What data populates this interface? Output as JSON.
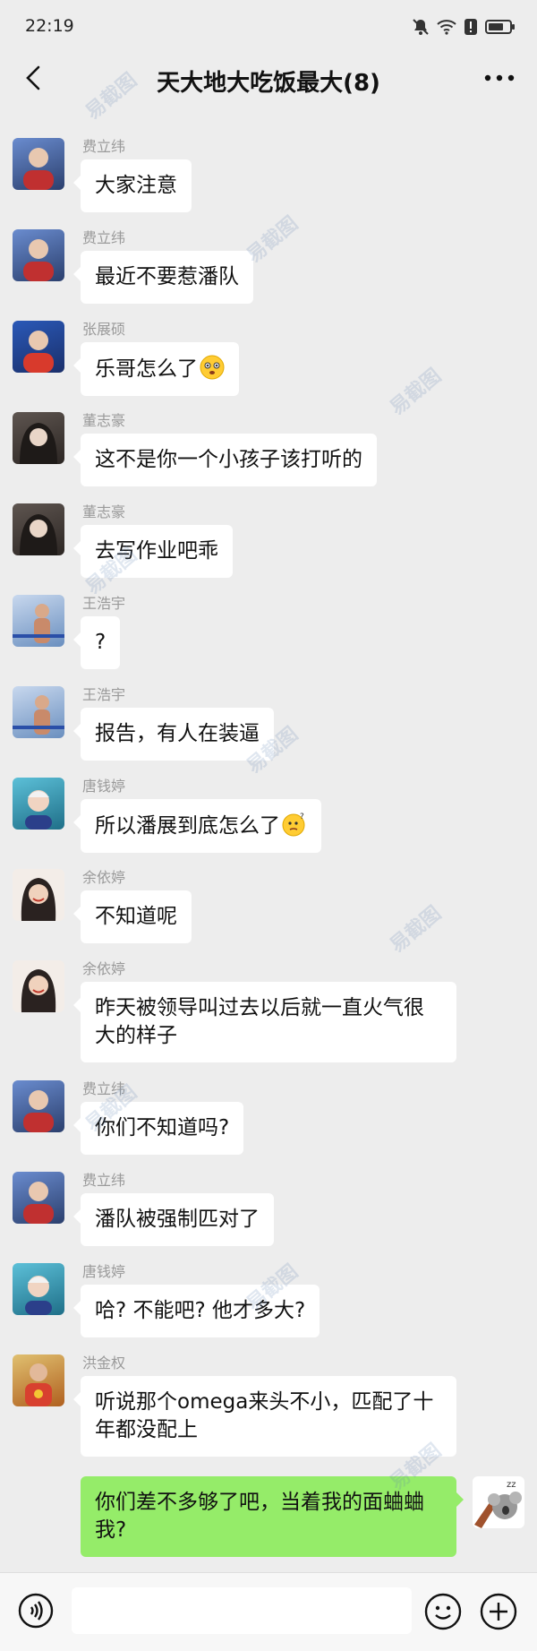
{
  "status_bar": {
    "time": "22:19",
    "icons": [
      "mute-bell-icon",
      "wifi-icon",
      "alert-icon",
      "battery-icon"
    ]
  },
  "header": {
    "title": "天大地大吃饭最大(8)",
    "back_icon": "chevron-left-icon",
    "more_icon": "more-dots-icon"
  },
  "messages": [
    {
      "sender": "费立纬",
      "text": "大家注意",
      "avatar_color": "#3a5a8a"
    },
    {
      "sender": "费立纬",
      "text": "最近不要惹潘队",
      "avatar_color": "#3a5a8a"
    },
    {
      "sender": "张展硕",
      "text": "乐哥怎么了",
      "emoji": "flushed-face-icon",
      "avatar_color": "#c0382b"
    },
    {
      "sender": "董志豪",
      "text": "这不是你一个小孩子该打听的",
      "avatar_color": "#4a3f3a"
    },
    {
      "sender": "董志豪",
      "text": "去写作业吧乖",
      "avatar_color": "#4a3f3a"
    },
    {
      "sender": "王浩宇",
      "text": "?",
      "avatar_color": "#6a8fbf"
    },
    {
      "sender": "王浩宇",
      "text": "报告，有人在装逼",
      "avatar_color": "#6a8fbf"
    },
    {
      "sender": "唐钱婷",
      "text": "所以潘展到底怎么了",
      "emoji": "thinking-face-icon",
      "avatar_color": "#2f8fa8"
    },
    {
      "sender": "余依婷",
      "text": "不知道呢",
      "avatar_color": "#d9cfc6"
    },
    {
      "sender": "余依婷",
      "text": "昨天被领导叫过去以后就一直火气很大的样子",
      "avatar_color": "#d9cfc6"
    },
    {
      "sender": "费立纬",
      "text": "你们不知道吗?",
      "avatar_color": "#3a5a8a"
    },
    {
      "sender": "费立纬",
      "text": "潘队被强制匹对了",
      "avatar_color": "#3a5a8a"
    },
    {
      "sender": "唐钱婷",
      "text": "哈? 不能吧? 他才多大?",
      "avatar_color": "#2f8fa8"
    },
    {
      "sender": "洪金权",
      "text": "听说那个omega来头不小，匹配了十年都没配上",
      "avatar_color": "#c99a3a"
    }
  ],
  "my_message": {
    "text": "你们差不多够了吧，当着我的面蛐蛐我?",
    "avatar_icon": "sleeping-koala-icon"
  },
  "input_bar": {
    "placeholder": "",
    "voice_icon": "voice-icon",
    "emoji_icon": "smiley-icon",
    "plus_icon": "plus-circle-icon"
  },
  "watermark": "易截图"
}
